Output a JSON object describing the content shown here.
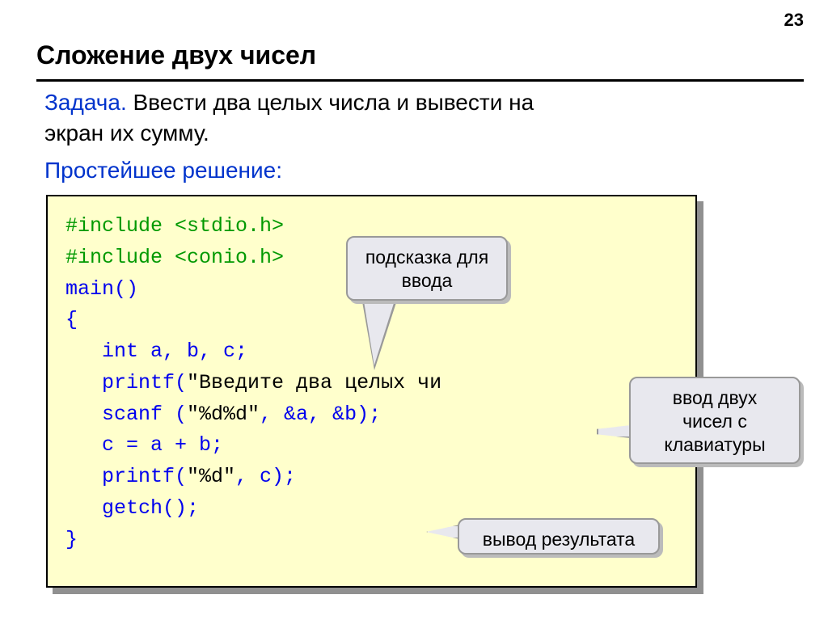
{
  "page_number": "23",
  "title": "Сложение двух чисел",
  "task": {
    "label": "Задача.",
    "text_line1": " Ввести два целых числа и вывести на",
    "text_line2": "экран их сумму."
  },
  "solution_label": "Простейшее решение:",
  "code": {
    "line1": "#include <stdio.h>",
    "line2": "#include <conio.h>",
    "line3": "main()",
    "line4": "{",
    "line5": "   int a, b, c;",
    "line6a": "   printf(",
    "line6b": "\"Введите два целых чи",
    "line7a": "   scanf (",
    "line7b": "\"%d%d\"",
    "line7c": ", &a, &b);",
    "line8": "   c = a + b;",
    "line9a": "   printf(",
    "line9b": "\"%d\"",
    "line9c": ", c);",
    "line10": "   getch();",
    "line11": "}"
  },
  "callouts": {
    "c1_line1": "подсказка для",
    "c1_line2": "ввода",
    "c2_line1": "ввод двух",
    "c2_line2": "чисел с",
    "c2_line3": "клавиатуры",
    "c3": "вывод результата"
  }
}
